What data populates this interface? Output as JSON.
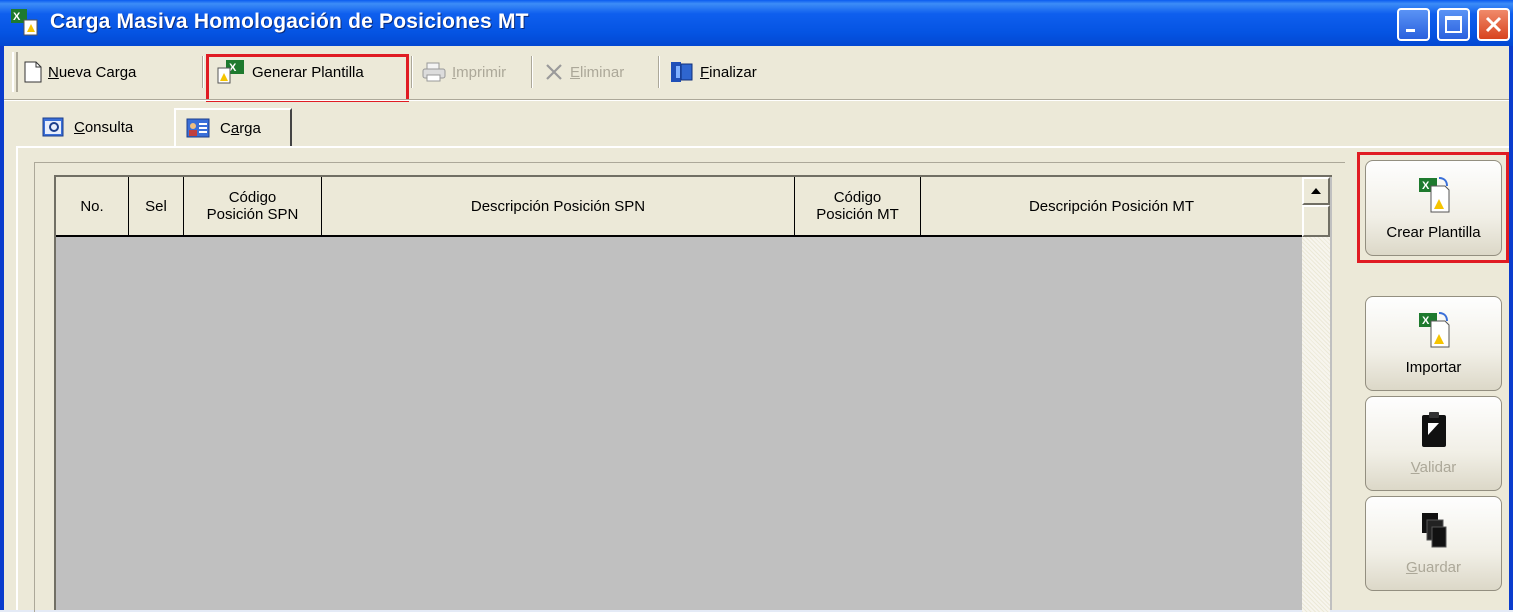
{
  "window": {
    "title": "Carga Masiva Homologación de Posiciones MT"
  },
  "toolbar": {
    "nueva_carga": {
      "accel": "N",
      "rest": "ueva Carga"
    },
    "generar_plantilla": {
      "label": "Generar Plantilla"
    },
    "imprimir": {
      "accel": "I",
      "rest": "mprimir"
    },
    "eliminar": {
      "accel": "E",
      "rest": "liminar"
    },
    "finalizar": {
      "accel": "F",
      "rest": "inalizar"
    }
  },
  "tabs": {
    "consulta": {
      "accel": "C",
      "rest": "onsulta"
    },
    "carga": {
      "pre": "C",
      "accel": "a",
      "rest": "rga"
    }
  },
  "grid": {
    "columns": [
      {
        "line1": "No.",
        "line2": ""
      },
      {
        "line1": "Sel",
        "line2": ""
      },
      {
        "line1": "Código",
        "line2": "Posición SPN"
      },
      {
        "line1": "Descripción Posición SPN",
        "line2": ""
      },
      {
        "line1": "Código",
        "line2": "Posición MT"
      },
      {
        "line1": "Descripción Posición MT",
        "line2": ""
      }
    ],
    "rows": []
  },
  "side_buttons": {
    "crear_plantilla": {
      "label": "Crear Plantilla"
    },
    "importar": {
      "label": "Importar"
    },
    "validar": {
      "accel": "V",
      "rest": "alidar"
    },
    "guardar": {
      "accel": "G",
      "rest": "uardar"
    }
  },
  "colors": {
    "highlight": "#e01c23",
    "titlebar": "#0554e3",
    "grid_bg": "#c0c0c0"
  },
  "icons": [
    "excel-icon",
    "new-document-icon",
    "printer-icon",
    "delete-x-icon",
    "exit-door-icon",
    "query-icon",
    "card-icon",
    "clipboard-icon",
    "save-pages-icon"
  ]
}
